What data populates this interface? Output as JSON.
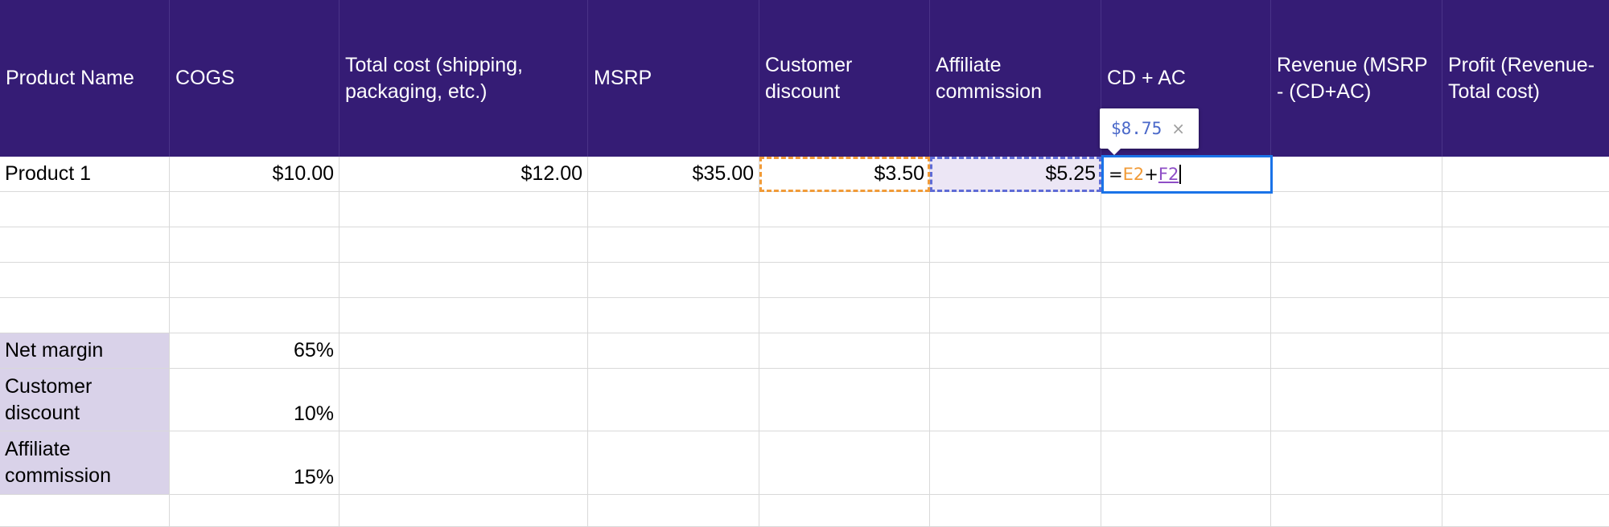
{
  "headers": [
    "Product Name",
    "COGS",
    "Total cost (shipping, packaging, etc.)",
    "MSRP",
    "Customer discount",
    "Affiliate commission",
    "CD + AC",
    "Revenue (MSRP - (CD+AC)",
    "Profit (Revenue-Total cost)"
  ],
  "product_row": {
    "name": "Product 1",
    "cogs": "$10.00",
    "total_cost": "$12.00",
    "msrp": "$35.00",
    "customer_discount": "$3.50",
    "affiliate_commission": "$5.25"
  },
  "formula_editor": {
    "prefix": "=",
    "ref1": "E2",
    "operator": "+",
    "ref2": "F2"
  },
  "formula_tooltip": {
    "result": "$8.75",
    "close_glyph": "×"
  },
  "assumptions": [
    {
      "label": "Net margin",
      "value": "65%"
    },
    {
      "label": "Customer discount",
      "value": "10%"
    },
    {
      "label": "Affiliate commission",
      "value": "15%"
    }
  ],
  "colors": {
    "header_bg": "#351c75",
    "label_bg": "#d9d2e9",
    "edit_border": "#1a73e8",
    "ref_e": "#f19b38",
    "ref_f": "#8e4ec6"
  }
}
